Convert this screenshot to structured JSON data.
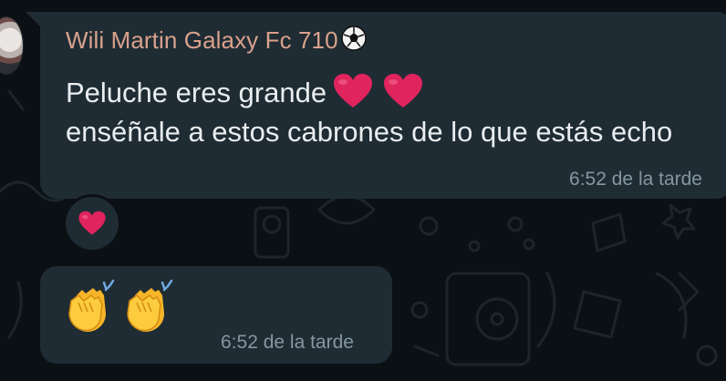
{
  "chat": {
    "message_1": {
      "sender": "Wili Martin Galaxy Fc 710",
      "sender_icon": "soccer-ball-icon",
      "line1": "Peluche eres grande",
      "line1_icons": [
        "red-heart-icon",
        "red-heart-icon"
      ],
      "line2": "enséñale a estos cabrones de lo que estás echo",
      "time": "6:52 de la tarde",
      "reaction": "red-heart-icon"
    },
    "message_2": {
      "icons": [
        "clapping-hands-icon",
        "clapping-hands-icon"
      ],
      "time": "6:52 de la tarde"
    }
  },
  "colors": {
    "background": "#0b1014",
    "bubble": "#1f2c33",
    "sender_name": "#d9a18d",
    "message_text": "#e9edef",
    "timestamp": "#8696a0",
    "heart": "#e0245e"
  }
}
